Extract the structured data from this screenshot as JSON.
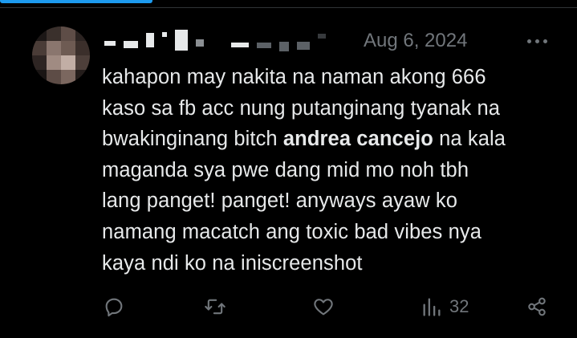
{
  "tweet": {
    "date": "Aug 6, 2024",
    "text_before": "kahapon may nakita na naman akong 666\nkaso sa fb acc nung putanginang tyanak na\nbwakinginang bitch ",
    "text_bold": "andrea cancejo",
    "text_after": " na kala\nmaganda sya pwe dang mid mo noh tbh\nlang panget! panget! anyways ayaw ko\nnamang macatch ang toxic bad vibes nya\nkaya ndi ko na iniscreenshot"
  },
  "actions": {
    "reply_icon": "reply-icon",
    "retweet_icon": "retweet-icon",
    "like_icon": "heart-icon",
    "views_icon": "views-icon",
    "views_count": "32",
    "share_icon": "share-icon"
  },
  "colors": {
    "background": "#000000",
    "text": "#e7e9ea",
    "muted": "#71767b",
    "accent": "#1d9bf0"
  }
}
